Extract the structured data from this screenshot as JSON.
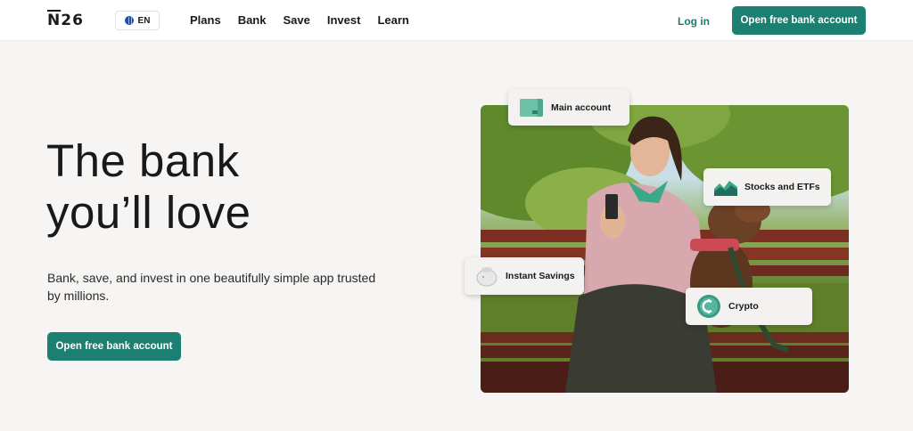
{
  "header": {
    "logo": "N26",
    "language": "EN",
    "nav": [
      "Plans",
      "Bank",
      "Save",
      "Invest",
      "Learn"
    ],
    "login": "Log in",
    "cta": "Open free bank account"
  },
  "hero": {
    "headline_line1": "The bank",
    "headline_line2": "you’ll love",
    "subtext": "Bank, save, and invest in one beautifully simple app trusted by millions.",
    "cta": "Open free bank account"
  },
  "cards": {
    "main_account": "Main account",
    "stocks": "Stocks and ETFs",
    "savings": "Instant Savings",
    "crypto": "Crypto"
  },
  "colors": {
    "accent": "#1b7f71",
    "background": "#f7f5f3"
  }
}
